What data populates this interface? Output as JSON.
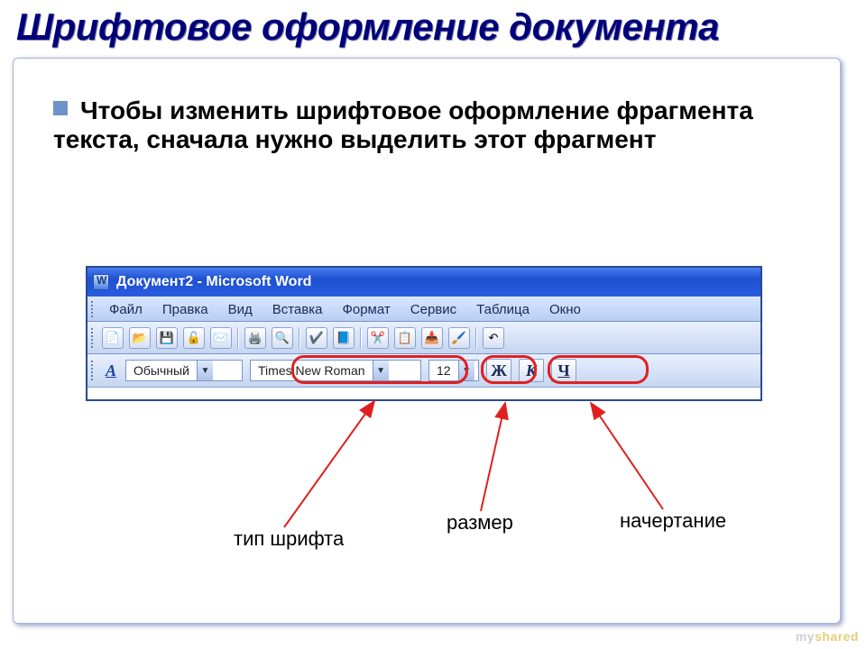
{
  "slide": {
    "title": "Шрифтовое оформление документа",
    "bullet": "Чтобы изменить шрифтовое оформление фрагмента текста, сначала нужно выделить этот фрагмент"
  },
  "word": {
    "titlebar": "Документ2 - Microsoft Word",
    "menu": {
      "file": "Файл",
      "edit": "Правка",
      "view": "Вид",
      "insert": "Вставка",
      "format": "Формат",
      "tools": "Сервис",
      "table": "Таблица",
      "window": "Окно"
    },
    "format": {
      "style_value": "Обычный",
      "font_value": "Times New Roman",
      "size_value": "12",
      "bold_label": "Ж",
      "italic_label": "К",
      "underline_label": "Ч"
    }
  },
  "callouts": {
    "font_type": "тип шрифта",
    "size": "размер",
    "style": "начертание"
  },
  "watermark": {
    "a": "my",
    "b": "shared"
  },
  "colors": {
    "accent": "#1e50d0",
    "ring": "#e02020"
  }
}
